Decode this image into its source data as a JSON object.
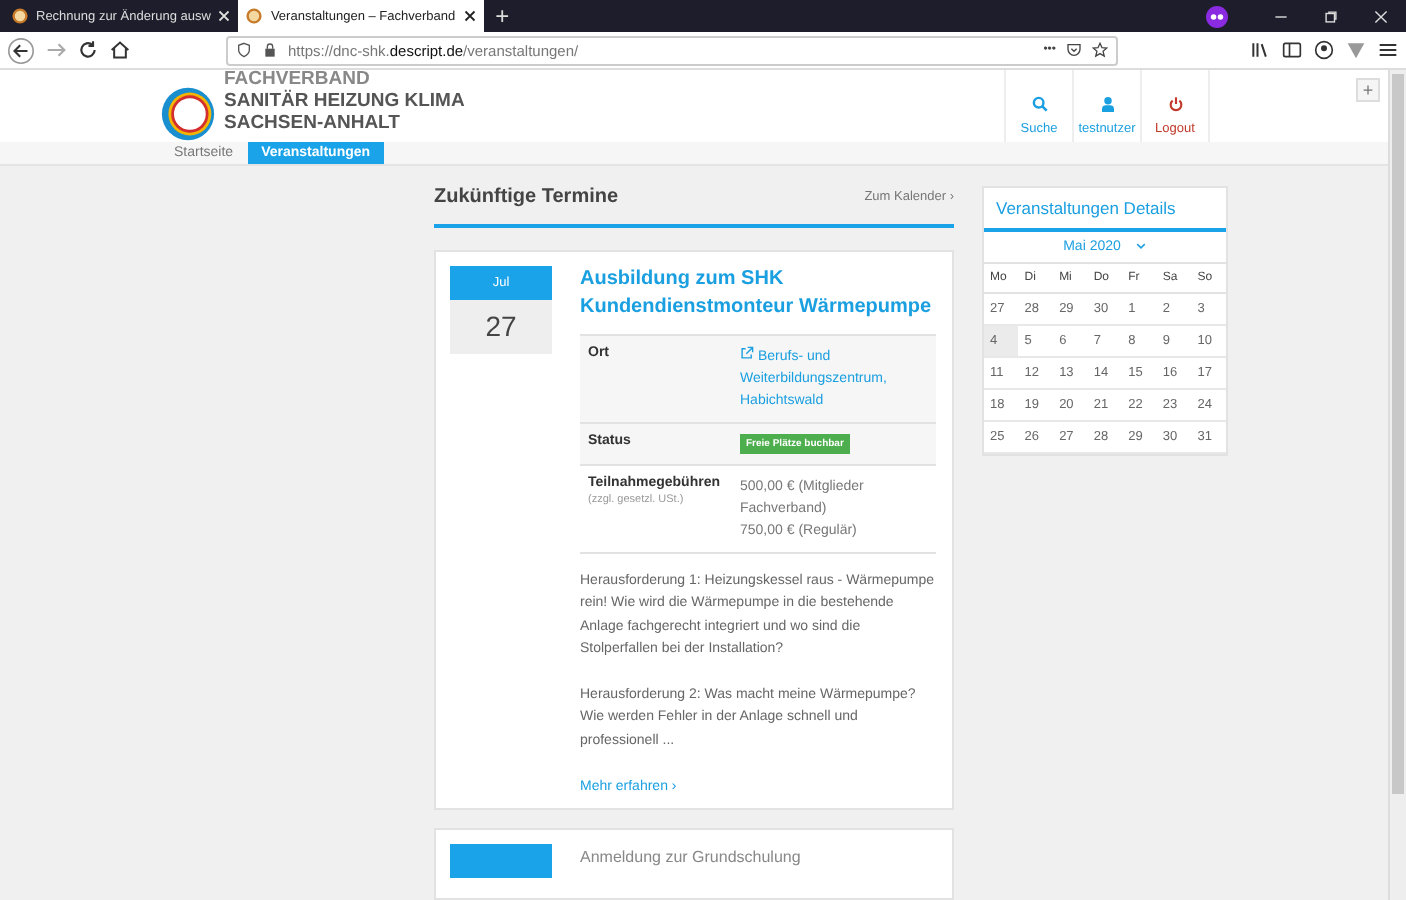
{
  "browser": {
    "tabs": [
      {
        "title": "Rechnung zur Änderung ausw",
        "selected": false
      },
      {
        "title": "Veranstaltungen – Fachverband",
        "selected": true
      }
    ],
    "new_tab": "+",
    "url": {
      "prefix": "https://dnc-shk.",
      "domain": "descript.de",
      "path": "/veranstaltungen/"
    },
    "more": "•••"
  },
  "page_add": "+",
  "header": {
    "org_line1": "FACHVERBAND",
    "org_line2": "SANITÄR HEIZUNG KLIMA",
    "org_line3": "SACHSEN-ANHALT",
    "actions": [
      {
        "kind": "search",
        "label": "Suche"
      },
      {
        "kind": "user",
        "label": "testnutzer"
      },
      {
        "kind": "logout",
        "label": "Logout"
      }
    ]
  },
  "nav": [
    {
      "label": "Startseite",
      "selected": false
    },
    {
      "label": "Veranstaltungen",
      "selected": true
    }
  ],
  "main": {
    "title": "Zukünftige Termine",
    "calendar_link": "Zum Kalender ›",
    "events": [
      {
        "month": "Jul",
        "day": "27",
        "title": "Ausbildung zum SHK Kundendienstmonteur Wärmepumpe",
        "details": [
          {
            "kind": "link",
            "label": "Ort",
            "value": "Berufs- und Weiterbildungszentrum, Habichtswald"
          },
          {
            "kind": "badge",
            "label": "Status",
            "value": "Freie Plätze buchbar"
          },
          {
            "kind": "text",
            "label": "Teilnahmegebühren",
            "note": "(zzgl. gesetzl. USt.)",
            "lines": [
              "500,00 € (Mitglieder Fachverband)",
              "750,00 € (Regulär)"
            ]
          }
        ],
        "paragraphs": [
          "Herausforderung 1: Heizungskessel raus - Wärmepumpe rein! Wie wird die Wärmepumpe in die bestehende Anlage fachgerecht integriert und wo sind die Stolperfallen bei der Installation?",
          "Herausforderung 2: Was macht meine Wärmepumpe? Wie werden Fehler in der Anlage schnell und professionell ..."
        ],
        "more": "Mehr erfahren ›"
      },
      {
        "title": "Anmeldung zur Grundschulung"
      }
    ]
  },
  "sidebar": {
    "title": "Veranstaltungen Details",
    "month": "Mai 2020",
    "weekdays": [
      "Mo",
      "Di",
      "Mi",
      "Do",
      "Fr",
      "Sa",
      "So"
    ],
    "weeks": [
      [
        {
          "d": "27",
          "selected": false
        },
        {
          "d": "28",
          "selected": false
        },
        {
          "d": "29",
          "selected": false
        },
        {
          "d": "30",
          "selected": false
        },
        {
          "d": "1",
          "selected": false
        },
        {
          "d": "2",
          "selected": false
        },
        {
          "d": "3",
          "selected": false
        }
      ],
      [
        {
          "d": "4",
          "selected": true
        },
        {
          "d": "5",
          "selected": false
        },
        {
          "d": "6",
          "selected": false
        },
        {
          "d": "7",
          "selected": false
        },
        {
          "d": "8",
          "selected": false
        },
        {
          "d": "9",
          "selected": false
        },
        {
          "d": "10",
          "selected": false
        }
      ],
      [
        {
          "d": "11",
          "selected": false
        },
        {
          "d": "12",
          "selected": false
        },
        {
          "d": "13",
          "selected": false
        },
        {
          "d": "14",
          "selected": false
        },
        {
          "d": "15",
          "selected": false
        },
        {
          "d": "16",
          "selected": false
        },
        {
          "d": "17",
          "selected": false
        }
      ],
      [
        {
          "d": "18",
          "selected": false
        },
        {
          "d": "19",
          "selected": false
        },
        {
          "d": "20",
          "selected": false
        },
        {
          "d": "21",
          "selected": false
        },
        {
          "d": "22",
          "selected": false
        },
        {
          "d": "23",
          "selected": false
        },
        {
          "d": "24",
          "selected": false
        }
      ],
      [
        {
          "d": "25",
          "selected": false
        },
        {
          "d": "26",
          "selected": false
        },
        {
          "d": "27",
          "selected": false
        },
        {
          "d": "28",
          "selected": false
        },
        {
          "d": "29",
          "selected": false
        },
        {
          "d": "30",
          "selected": false
        },
        {
          "d": "31",
          "selected": false
        }
      ]
    ]
  }
}
